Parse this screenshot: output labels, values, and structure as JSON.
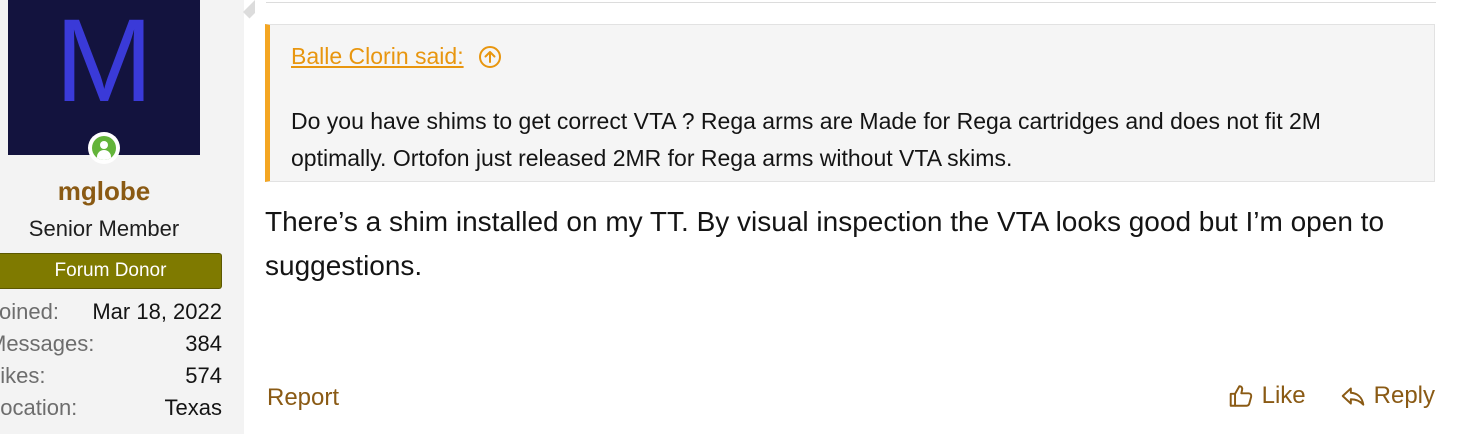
{
  "user": {
    "avatar_letter": "M",
    "username": "mglobe",
    "title": "Senior Member",
    "banner": "Forum Donor",
    "stats": [
      {
        "label": "Joined:",
        "value": "Mar 18, 2022"
      },
      {
        "label": "Messages:",
        "value": "384"
      },
      {
        "label": "Likes:",
        "value": "574"
      },
      {
        "label": "Location:",
        "value": "Texas"
      }
    ]
  },
  "quote": {
    "author": "Balle Clorin said:",
    "text": "Do you have shims to get correct VTA ? Rega arms are Made for Rega cartridges and does not fit 2M optimally. Ortofon just released 2MR for Rega arms without VTA skims."
  },
  "post": {
    "text": "There’s a shim installed on my TT. By visual inspection the VTA looks good but I’m open to suggestions."
  },
  "actions": {
    "report": "Report",
    "like": "Like",
    "reply": "Reply"
  },
  "colors": {
    "accent": "#8a5a14",
    "quote_bar": "#f4a622",
    "avatar_bg": "#13133e",
    "avatar_letter": "#3a3ad8",
    "banner_bg": "#7f7a00",
    "online": "#63b43a"
  },
  "icons": [
    "online-status-icon",
    "jump-to-quote-icon",
    "thumbs-up-icon",
    "reply-icon"
  ]
}
